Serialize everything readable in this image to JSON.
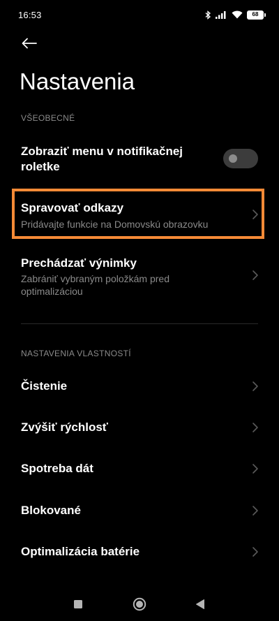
{
  "status_bar": {
    "time": "16:53",
    "battery": "68",
    "icons": [
      "bluetooth-icon",
      "signal-icon",
      "wifi-icon",
      "battery-icon"
    ]
  },
  "header": {
    "back_icon": "back-arrow-icon",
    "title": "Nastavenia"
  },
  "sections": {
    "general": {
      "header": "VŠEOBECNÉ",
      "notification_toggle": {
        "title_line1": "Zobraziť menu v notifikačnej",
        "title_line2": "roletke",
        "state": "off"
      },
      "manage_shortcuts": {
        "title": "Spravovať odkazy",
        "subtitle": "Pridávajte funkcie na Domovskú obrazovku"
      },
      "browse_exceptions": {
        "title": "Prechádzať výnimky",
        "subtitle_line1": "Zabrániť vybraným položkám pred",
        "subtitle_line2": "optimalizáciou"
      }
    },
    "properties": {
      "header": "NASTAVENIA VLASTNOSTÍ",
      "items": [
        {
          "title": "Čistenie"
        },
        {
          "title": "Zvýšiť rýchlosť"
        },
        {
          "title": "Spotreba dát"
        },
        {
          "title": "Blokované"
        },
        {
          "title": "Optimalizácia batérie"
        }
      ]
    }
  },
  "highlight_color": "#f58a36",
  "nav_bar": {
    "buttons": [
      "recents-square-icon",
      "home-circle-icon",
      "back-triangle-icon"
    ]
  }
}
